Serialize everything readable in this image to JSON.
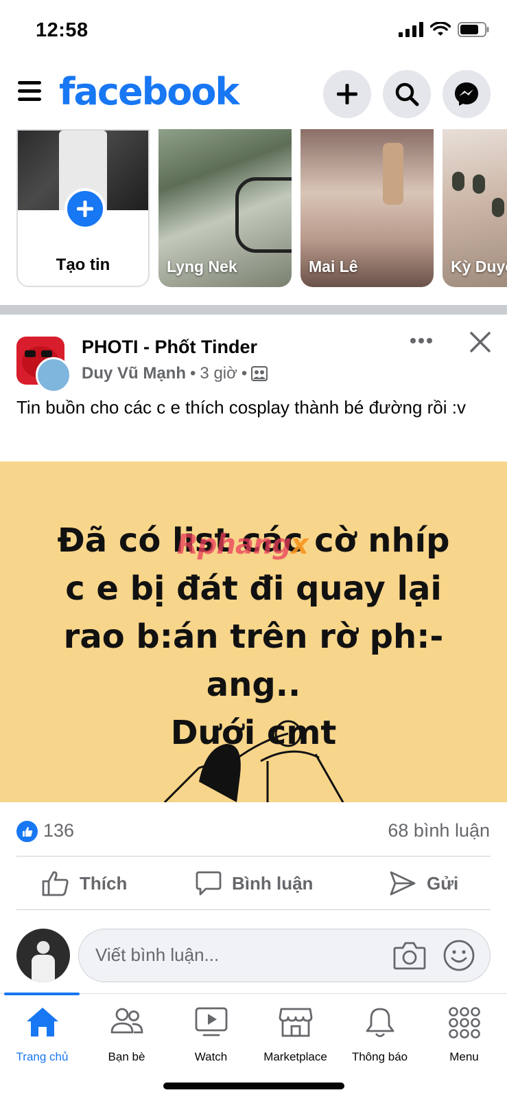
{
  "status_bar": {
    "time": "12:58"
  },
  "header": {
    "logo": "facebook",
    "icons": [
      "plus-icon",
      "search-icon",
      "messenger-icon"
    ]
  },
  "stories": {
    "create_label": "Tạo tin",
    "items": [
      {
        "name": "Lyng Nek"
      },
      {
        "name": "Mai Lê"
      },
      {
        "name": "Kỳ Duyên"
      }
    ]
  },
  "post": {
    "page_name": "PHOTI - Phốt Tinder",
    "author": "Duy Vũ Mạnh",
    "time": "3 giờ",
    "separator": "•",
    "text": "Tin buồn cho các c e thích cosplay thành bé đường rồi :v",
    "image_lines": [
      "Đã có list các cờ nhíp",
      "c e bị đát đi quay lại",
      "rao b:án trên rờ ph:-",
      "ang..",
      "Dưới cmt"
    ],
    "watermark": {
      "main": "Rphang",
      "x": "x"
    },
    "like_count": "136",
    "comment_count": "68 bình luận",
    "actions": {
      "like": "Thích",
      "comment": "Bình luận",
      "share": "Gửi"
    },
    "comment_placeholder": "Viết bình luận..."
  },
  "bottom_nav": [
    {
      "label": "Trang chủ",
      "icon": "home-icon",
      "active": true
    },
    {
      "label": "Bạn bè",
      "icon": "friends-icon",
      "active": false
    },
    {
      "label": "Watch",
      "icon": "watch-icon",
      "active": false
    },
    {
      "label": "Marketplace",
      "icon": "marketplace-icon",
      "active": false
    },
    {
      "label": "Thông báo",
      "icon": "bell-icon",
      "active": false
    },
    {
      "label": "Menu",
      "icon": "menu-grid-icon",
      "active": false
    }
  ],
  "colors": {
    "brand": "#1877f2",
    "image_bg": "#f7d58a",
    "secondary_text": "#65676b"
  }
}
